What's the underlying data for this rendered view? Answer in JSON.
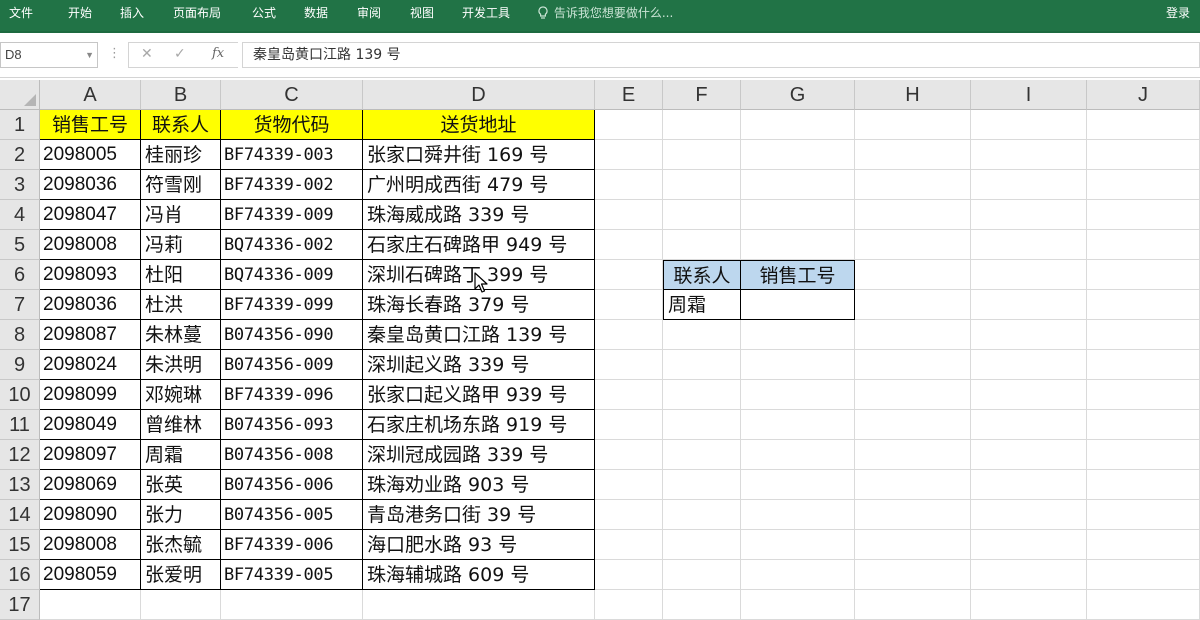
{
  "ribbon": {
    "tabs": [
      "文件",
      "开始",
      "插入",
      "页面布局",
      "公式",
      "数据",
      "审阅",
      "视图",
      "开发工具"
    ],
    "tell_me": "告诉我您想要做什么...",
    "login": "登录"
  },
  "formula_bar": {
    "name_box": "D8",
    "fx": "fx",
    "value": "秦皇岛黄口江路 139 号"
  },
  "columns": [
    "A",
    "B",
    "C",
    "D",
    "E",
    "F",
    "G",
    "H",
    "I",
    "J"
  ],
  "rows": [
    "1",
    "2",
    "3",
    "4",
    "5",
    "6",
    "7",
    "8",
    "9",
    "10",
    "11",
    "12",
    "13",
    "14",
    "15",
    "16",
    "17"
  ],
  "table": {
    "headers": [
      "销售工号",
      "联系人",
      "货物代码",
      "送货地址"
    ],
    "records": [
      [
        "2098005",
        "桂丽珍",
        "BF74339-003",
        "张家口舜井街 169 号"
      ],
      [
        "2098036",
        "符雪刚",
        "BF74339-002",
        "广州明成西街 479 号"
      ],
      [
        "2098047",
        "冯肖",
        "BF74339-009",
        "珠海威成路 339 号"
      ],
      [
        "2098008",
        "冯莉",
        "BQ74336-002",
        "石家庄石碑路甲 949 号"
      ],
      [
        "2098093",
        "杜阳",
        "BQ74336-009",
        "深圳石碑路丁 399 号"
      ],
      [
        "2098036",
        "杜洪",
        "BF74339-099",
        "珠海长春路 379 号"
      ],
      [
        "2098087",
        "朱林蔓",
        "B074356-090",
        "秦皇岛黄口江路 139 号"
      ],
      [
        "2098024",
        "朱洪明",
        "B074356-009",
        "深圳起义路 339 号"
      ],
      [
        "2098099",
        "邓婉琳",
        "BF74339-096",
        "张家口起义路甲 939 号"
      ],
      [
        "2098049",
        "曾维林",
        "B074356-093",
        "石家庄机场东路 919 号"
      ],
      [
        "2098097",
        "周霜",
        "B074356-008",
        "深圳冠成园路 339 号"
      ],
      [
        "2098069",
        "张英",
        "B074356-006",
        "珠海劝业路 903 号"
      ],
      [
        "2098090",
        "张力",
        "B074356-005",
        "青岛港务口街 39 号"
      ],
      [
        "2098008",
        "张杰毓",
        "BF74339-006",
        "海口肥水路 93 号"
      ],
      [
        "2098059",
        "张爱明",
        "BF74339-005",
        "珠海辅城路 609 号"
      ]
    ]
  },
  "lookup": {
    "header_name": "联系人",
    "header_id": "销售工号",
    "name": "周霜",
    "id": ""
  },
  "colors": {
    "ribbon": "#217346",
    "header_fill": "#ffff00",
    "lookup_fill": "#bdd7ee"
  },
  "selected_cell": "D8"
}
